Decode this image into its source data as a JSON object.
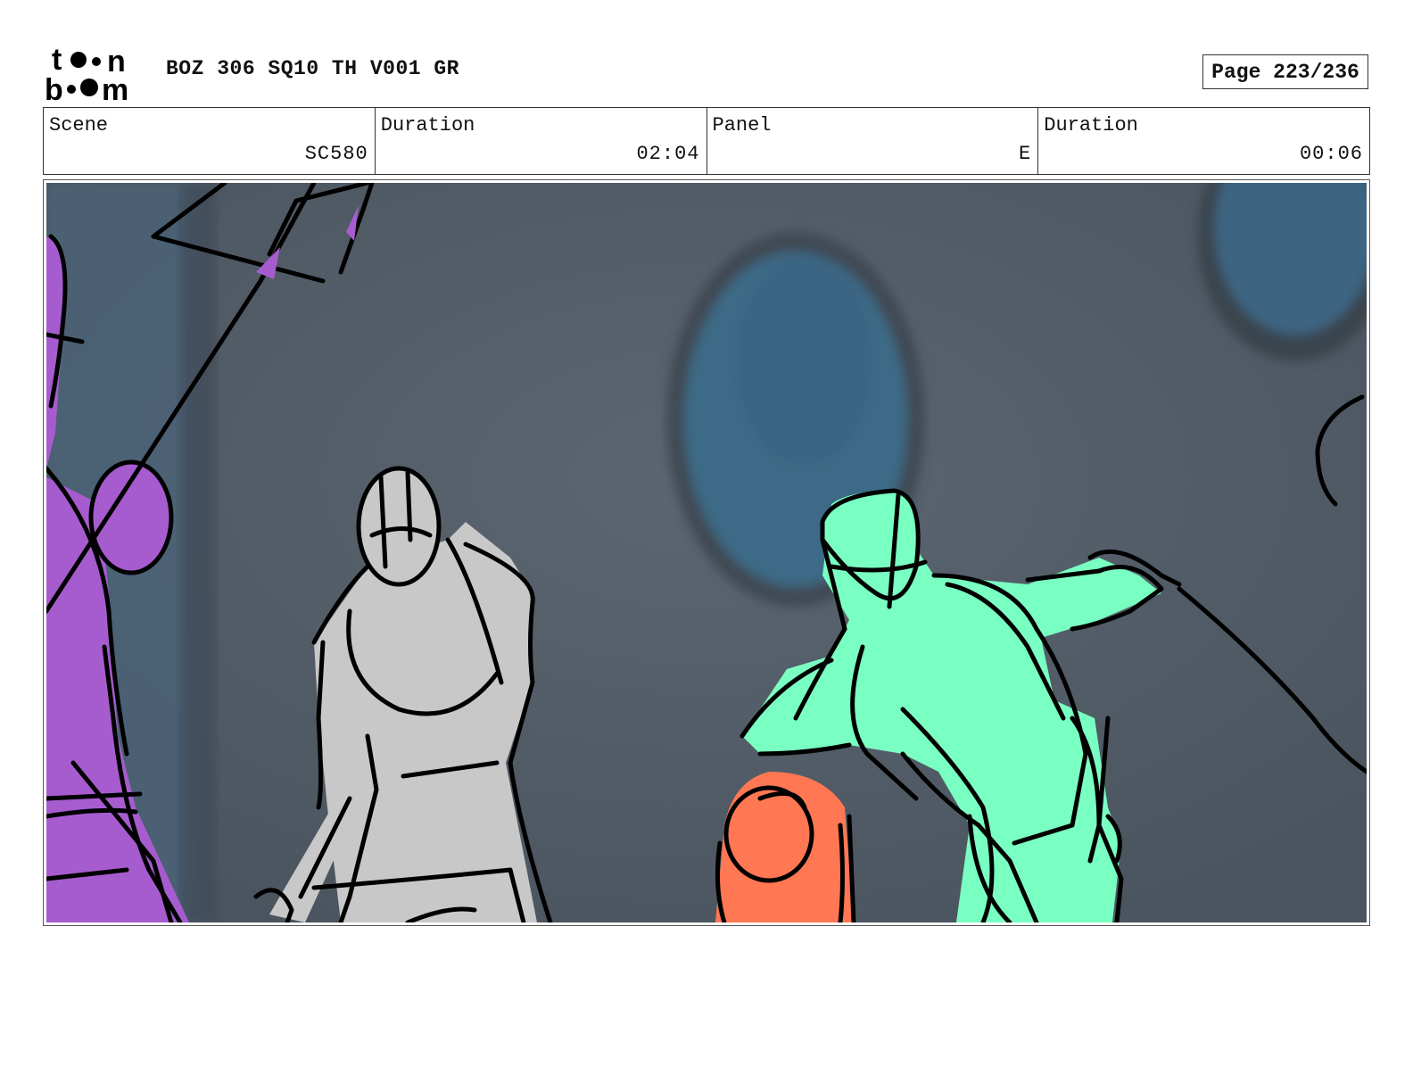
{
  "header": {
    "logo_text": "toon boom",
    "project_title": "BOZ 306 SQ10 TH V001 GR",
    "page_label": "Page 223/236"
  },
  "info": {
    "scene_label": "Scene",
    "scene_value": "SC580",
    "scene_duration_label": "Duration",
    "scene_duration_value": "02:04",
    "panel_label": "Panel",
    "panel_value": "E",
    "panel_duration_label": "Duration",
    "panel_duration_value": "00:06"
  },
  "colors": {
    "background_wall": "#535e69",
    "porthole_glass": "#3f6a85",
    "character_purple": "#a65ccf",
    "character_grey": "#c8c8c8",
    "character_green": "#7affc2",
    "character_orange": "#ff7753",
    "ink": "#000000"
  }
}
